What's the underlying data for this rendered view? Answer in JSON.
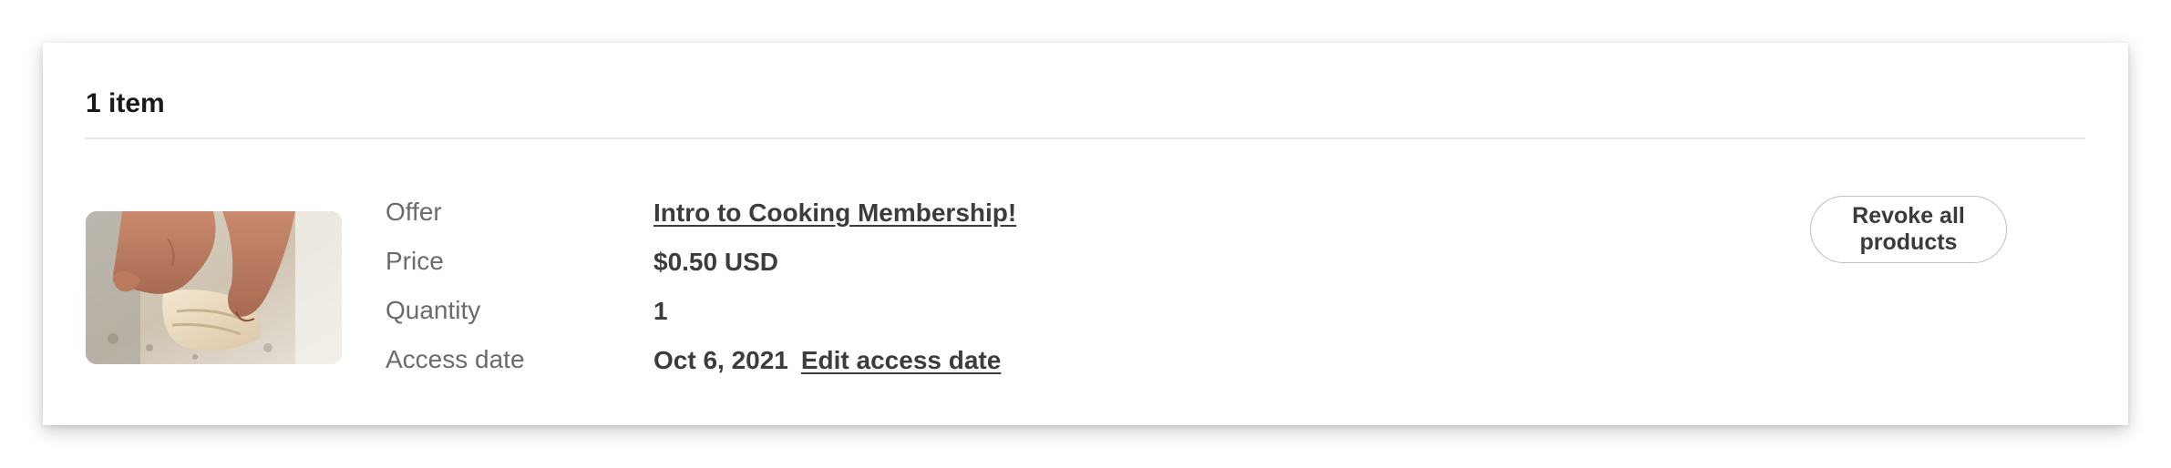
{
  "header": {
    "title": "1 item"
  },
  "item": {
    "image_alt": "Hands kneading dough",
    "labels": {
      "offer": "Offer",
      "price": "Price",
      "quantity": "Quantity",
      "access_date": "Access date"
    },
    "values": {
      "offer": "Intro to Cooking Membership!",
      "price": "$0.50 USD",
      "quantity": "1",
      "access_date": "Oct 6, 2021",
      "edit_access_date": "Edit access date"
    }
  },
  "actions": {
    "revoke_label": "Revoke all products"
  },
  "colors": {
    "text_primary": "#1a1a1a",
    "text_label": "#6b6b6b",
    "text_value": "#3c3c3c",
    "divider": "#e3e3e3",
    "button_border": "#bdbdbd"
  }
}
